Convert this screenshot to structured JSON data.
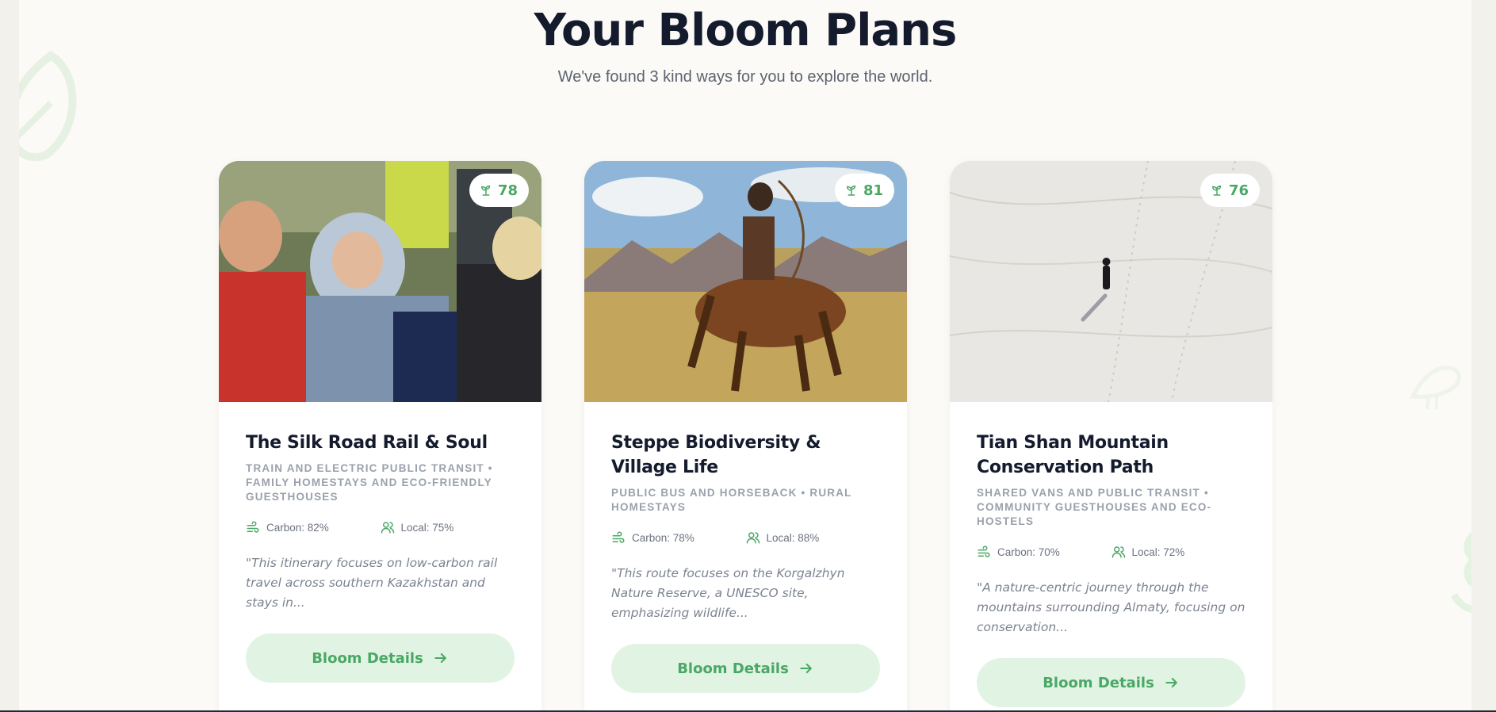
{
  "header": {
    "title": "Your Bloom Plans",
    "subtitle": "We've found 3 kind ways for you to explore the world."
  },
  "colors": {
    "accent": "#4aa865",
    "button_bg": "#e1f3e3",
    "title": "#141b2d",
    "background": "#fbfaf6"
  },
  "cards": [
    {
      "score": "78",
      "score_icon": "sprout-icon",
      "title": "The Silk Road Rail & Soul",
      "tags": "TRAIN AND ELECTRIC PUBLIC TRANSIT • FAMILY HOMESTAYS AND ECO-FRIENDLY GUESTHOUSES",
      "carbon": "Carbon: 82%",
      "local": "Local: 75%",
      "quote": "\"This itinerary focuses on low-carbon rail travel across southern Kazakhstan and stays in...",
      "button_label": "Bloom Details",
      "image_subject": "photo-astronaut-landing"
    },
    {
      "score": "81",
      "score_icon": "sprout-icon",
      "title": "Steppe Biodiversity & Village Life",
      "tags": "PUBLIC BUS AND HORSEBACK • RURAL HOMESTAYS",
      "carbon": "Carbon: 78%",
      "local": "Local: 88%",
      "quote": "\"This route focuses on the Korgalzhyn Nature Reserve, a UNESCO site, emphasizing wildlife...",
      "button_label": "Bloom Details",
      "image_subject": "photo-horse-archer-steppe"
    },
    {
      "score": "76",
      "score_icon": "sprout-icon",
      "title": "Tian Shan Mountain Conservation Path",
      "tags": "SHARED VANS AND PUBLIC TRANSIT • COMMUNITY GUESTHOUSES AND ECO-HOSTELS",
      "carbon": "Carbon: 70%",
      "local": "Local: 72%",
      "quote": "\"A nature-centric journey through the mountains surrounding Almaty, focusing on conservation...",
      "button_label": "Bloom Details",
      "image_subject": "photo-person-snowfield"
    }
  ]
}
